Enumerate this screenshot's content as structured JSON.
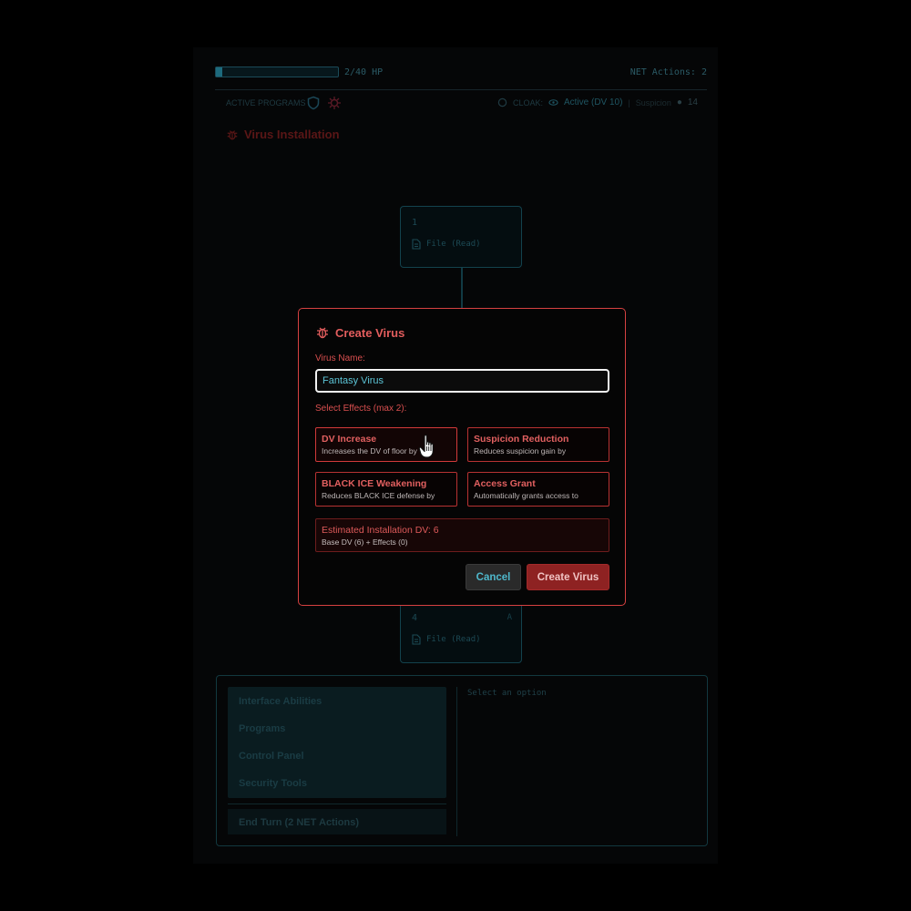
{
  "status_bar": {
    "hp_text": "2/40 HP",
    "hp_fraction": 0.05,
    "net_actions": "NET Actions: 2"
  },
  "programs_row": {
    "active_programs_label": "ACTIVE PROGRAMS",
    "cloak_label": "CLOAK:",
    "cloak_status": "Active (DV 10)",
    "suspicion_label": "Suspicion",
    "suspicion_value": "14"
  },
  "section": {
    "title": "Virus Installation"
  },
  "nodes": [
    {
      "number": "1",
      "file_label": "File (Read)",
      "corner": ""
    },
    {
      "number": "4",
      "file_label": "File (Read)",
      "corner": "A"
    }
  ],
  "bottom_menu": {
    "items": [
      {
        "label": "Interface Abilities"
      },
      {
        "label": "Programs"
      },
      {
        "label": "Control Panel"
      },
      {
        "label": "Security Tools"
      }
    ],
    "end_turn": "End Turn (2 NET Actions)",
    "detail_placeholder": "Select an option"
  },
  "modal": {
    "title": "Create Virus",
    "name_label": "Virus Name:",
    "name_value": "Fantasy Virus",
    "effects_label": "Select Effects (max 2):",
    "effects": [
      {
        "title": "DV Increase",
        "desc": "Increases the DV of floor by"
      },
      {
        "title": "Suspicion Reduction",
        "desc": "Reduces suspicion gain by"
      },
      {
        "title": "BLACK ICE Weakening",
        "desc": "Reduces BLACK ICE defense by"
      },
      {
        "title": "Access Grant",
        "desc": "Automatically grants access to"
      }
    ],
    "estimate_title": "Estimated Installation DV: 6",
    "estimate_detail": "Base DV (6) + Effects (0)",
    "cancel_label": "Cancel",
    "create_label": "Create Virus"
  },
  "colors": {
    "accent_red": "#d64141",
    "accent_teal": "#4fb8cc"
  }
}
